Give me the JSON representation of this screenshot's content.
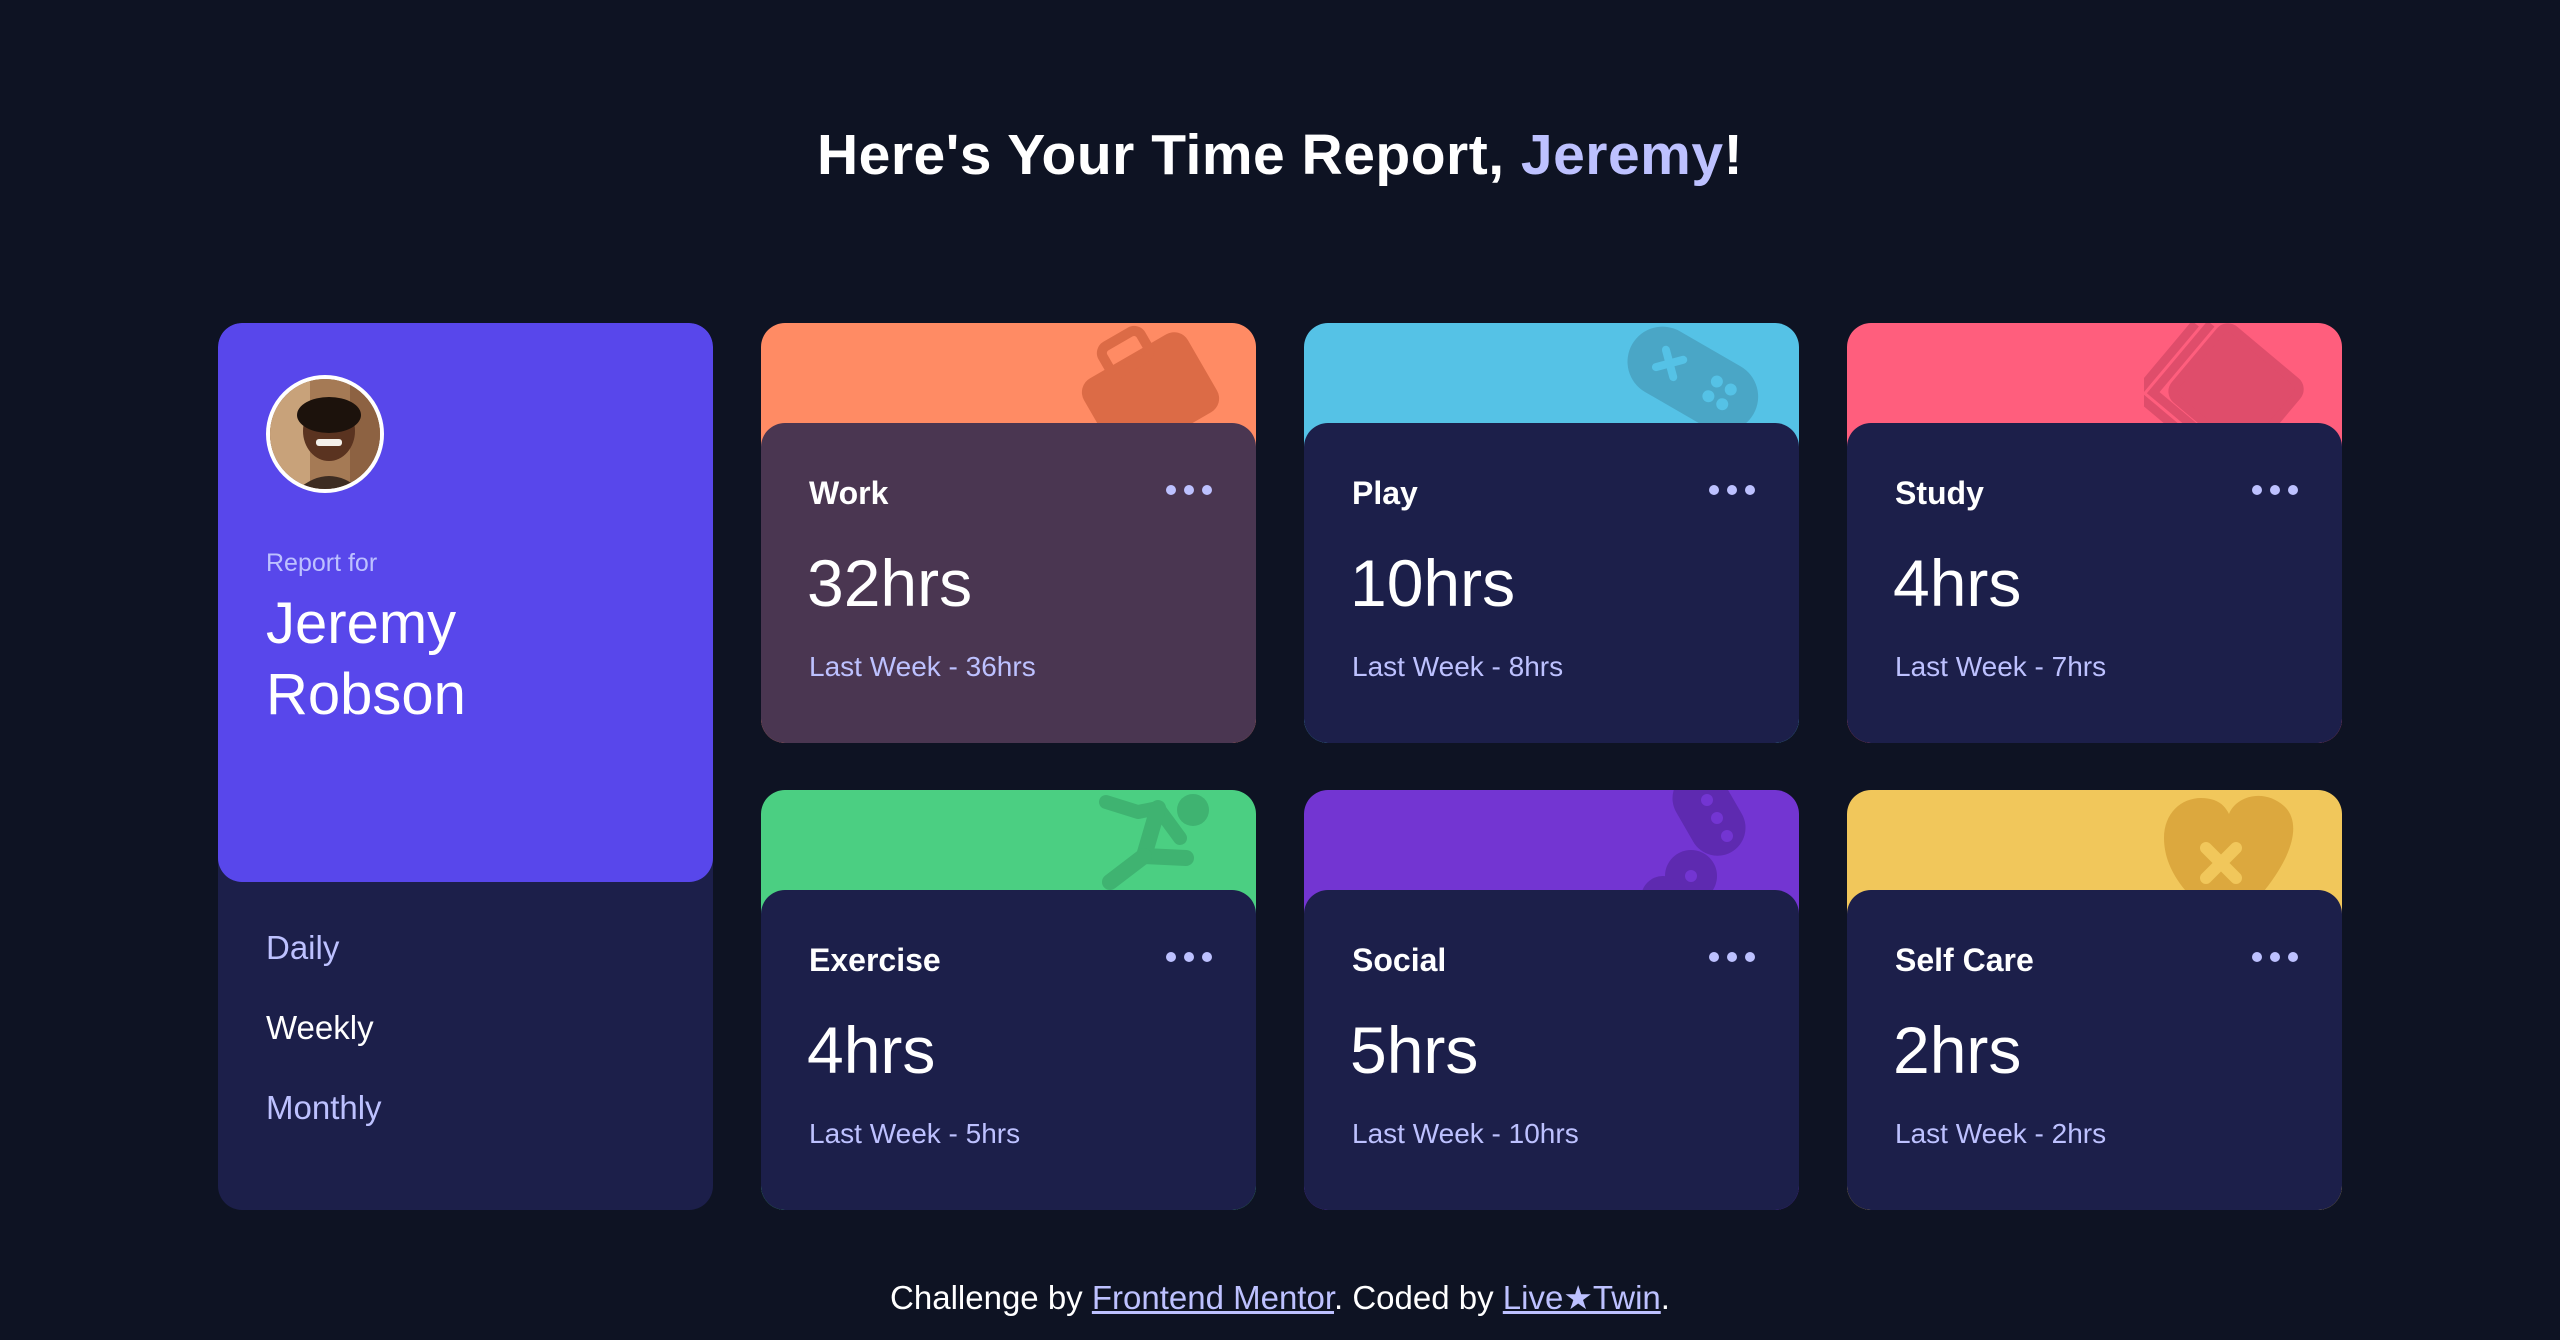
{
  "header": {
    "title_prefix": "Here's Your Time Report, ",
    "title_name": "Jeremy",
    "title_suffix": "!"
  },
  "profile": {
    "report_for": "Report for",
    "first_name": "Jeremy",
    "last_name": "Robson",
    "periods": [
      {
        "label": "Daily",
        "state": "muted"
      },
      {
        "label": "Weekly",
        "state": "active"
      },
      {
        "label": "Monthly",
        "state": "muted"
      }
    ]
  },
  "colors": {
    "background": "#0e1323",
    "card": "#1c1f4a",
    "profile": "#5847eb",
    "accent_text": "#bdc1ff",
    "work": "#ff8b64",
    "play": "#55c2e6",
    "study": "#ff5e7d",
    "exercise": "#4bcf82",
    "social": "#7335d2",
    "self_care": "#f1c75b"
  },
  "activities": [
    {
      "title": "Work",
      "hours": "32hrs",
      "previous": "Last Week - 36hrs",
      "icon": "briefcase-icon"
    },
    {
      "title": "Play",
      "hours": "10hrs",
      "previous": "Last Week - 8hrs",
      "icon": "gamepad-icon"
    },
    {
      "title": "Study",
      "hours": "4hrs",
      "previous": "Last Week - 7hrs",
      "icon": "book-icon"
    },
    {
      "title": "Exercise",
      "hours": "4hrs",
      "previous": "Last Week - 5hrs",
      "icon": "running-figure-icon"
    },
    {
      "title": "Social",
      "hours": "5hrs",
      "previous": "Last Week - 10hrs",
      "icon": "chat-bubbles-icon"
    },
    {
      "title": "Self Care",
      "hours": "2hrs",
      "previous": "Last Week - 2hrs",
      "icon": "heart-icon"
    }
  ],
  "footer": {
    "prefix": "Challenge by ",
    "link1": "Frontend Mentor",
    "middle": ". Coded by ",
    "link2": "Live★Twin",
    "suffix": "."
  }
}
